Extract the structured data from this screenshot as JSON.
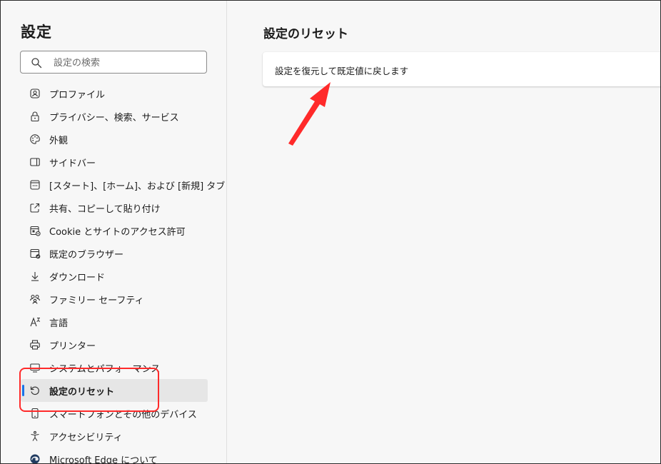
{
  "sidebar": {
    "title": "設定",
    "search": {
      "placeholder": "設定の検索",
      "value": ""
    },
    "items": [
      {
        "label": "プロファイル",
        "icon": "profile-icon"
      },
      {
        "label": "プライバシー、検索、サービス",
        "icon": "lock-icon"
      },
      {
        "label": "外観",
        "icon": "palette-icon"
      },
      {
        "label": "サイドバー",
        "icon": "sidebar-icon"
      },
      {
        "label": "[スタート]、[ホーム]、および [新規] タブ",
        "icon": "start-page-icon"
      },
      {
        "label": "共有、コピーして貼り付け",
        "icon": "share-icon"
      },
      {
        "label": "Cookie とサイトのアクセス許可",
        "icon": "site-permissions-icon"
      },
      {
        "label": "既定のブラウザー",
        "icon": "default-browser-icon"
      },
      {
        "label": "ダウンロード",
        "icon": "download-icon"
      },
      {
        "label": "ファミリー セーフティ",
        "icon": "family-icon"
      },
      {
        "label": "言語",
        "icon": "language-icon"
      },
      {
        "label": "プリンター",
        "icon": "printer-icon"
      },
      {
        "label": "システムとパフォーマンス",
        "icon": "system-icon"
      },
      {
        "label": "設定のリセット",
        "icon": "reset-icon",
        "active": true
      },
      {
        "label": "スマートフォンとその他のデバイス",
        "icon": "phone-icon"
      },
      {
        "label": "アクセシビリティ",
        "icon": "accessibility-icon"
      },
      {
        "label": "Microsoft Edge について",
        "icon": "edge-logo-icon"
      }
    ]
  },
  "main": {
    "title": "設定のリセット",
    "card": {
      "label": "設定を復元して既定値に戻します"
    }
  },
  "annotations": {
    "highlight_color": "#ff2a2a",
    "arrow_color": "#ff2a2a"
  },
  "colors": {
    "active_indicator": "#1a73e8",
    "active_background": "#e6e6e6",
    "background": "#f7f7f7"
  }
}
